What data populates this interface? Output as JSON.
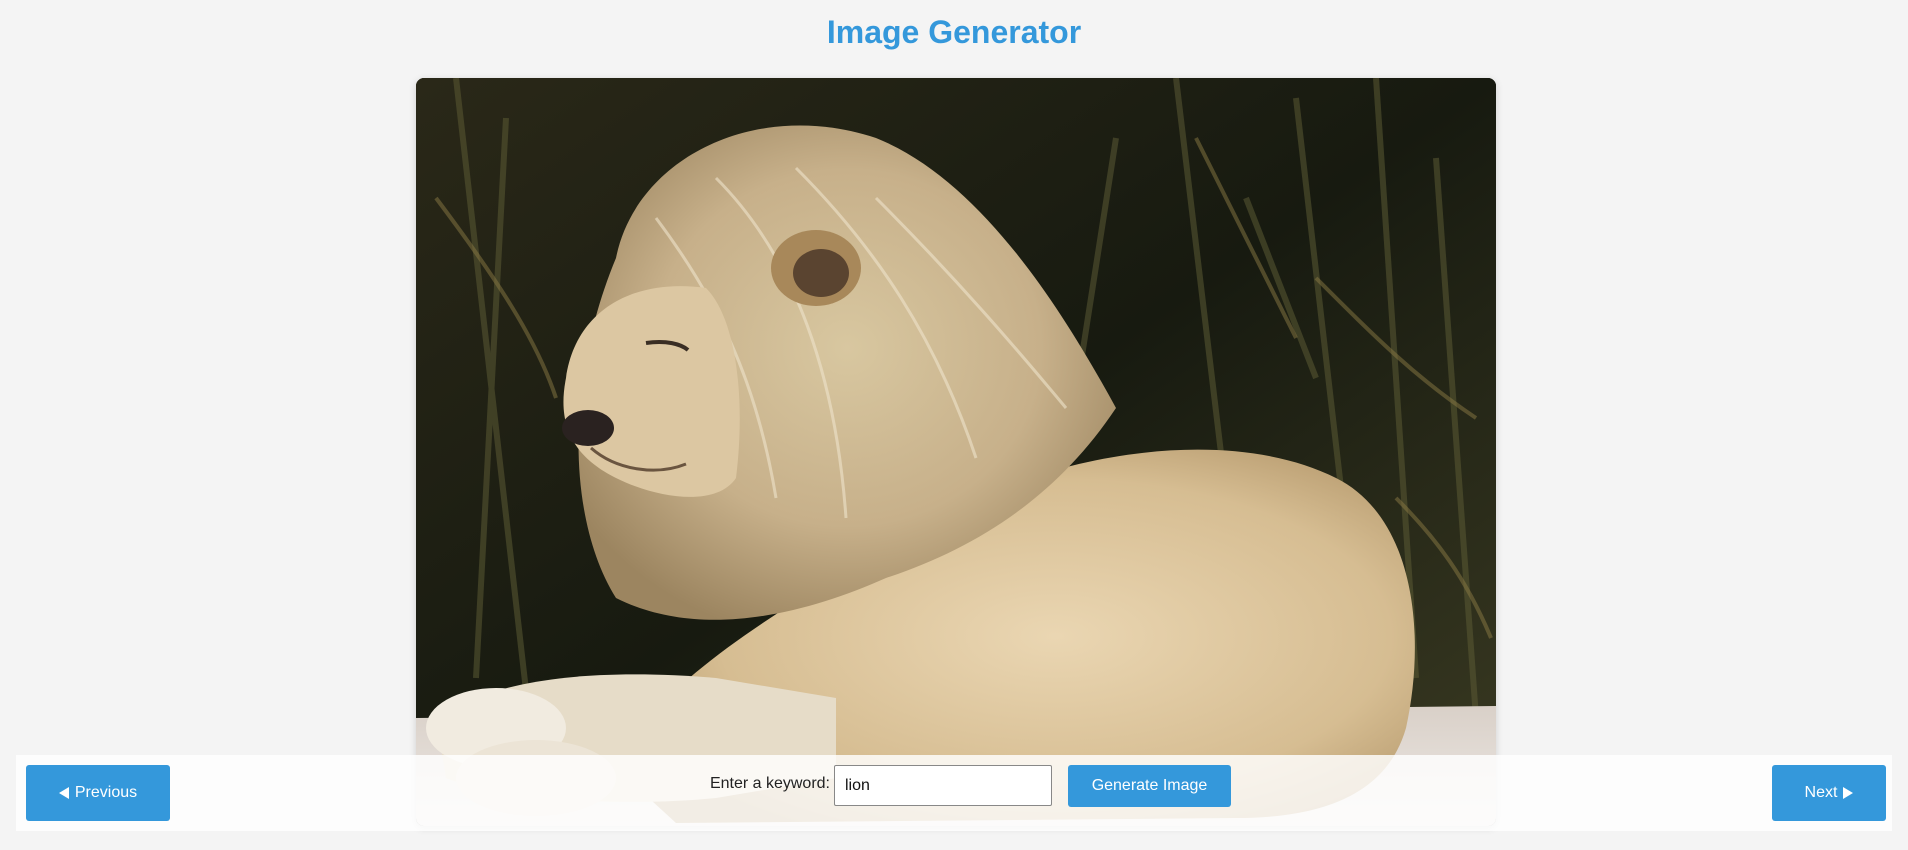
{
  "header": {
    "title": "Image Generator"
  },
  "image": {
    "subject": "lion",
    "alt": "lion"
  },
  "controls": {
    "previous_label": "Previous",
    "next_label": "Next",
    "keyword_label": "Enter a keyword:",
    "keyword_value": "lion",
    "generate_label": "Generate Image"
  },
  "colors": {
    "accent": "#3498db",
    "background": "#f4f4f4"
  },
  "icons": {
    "previous": "triangle-left-icon",
    "next": "triangle-right-icon"
  }
}
